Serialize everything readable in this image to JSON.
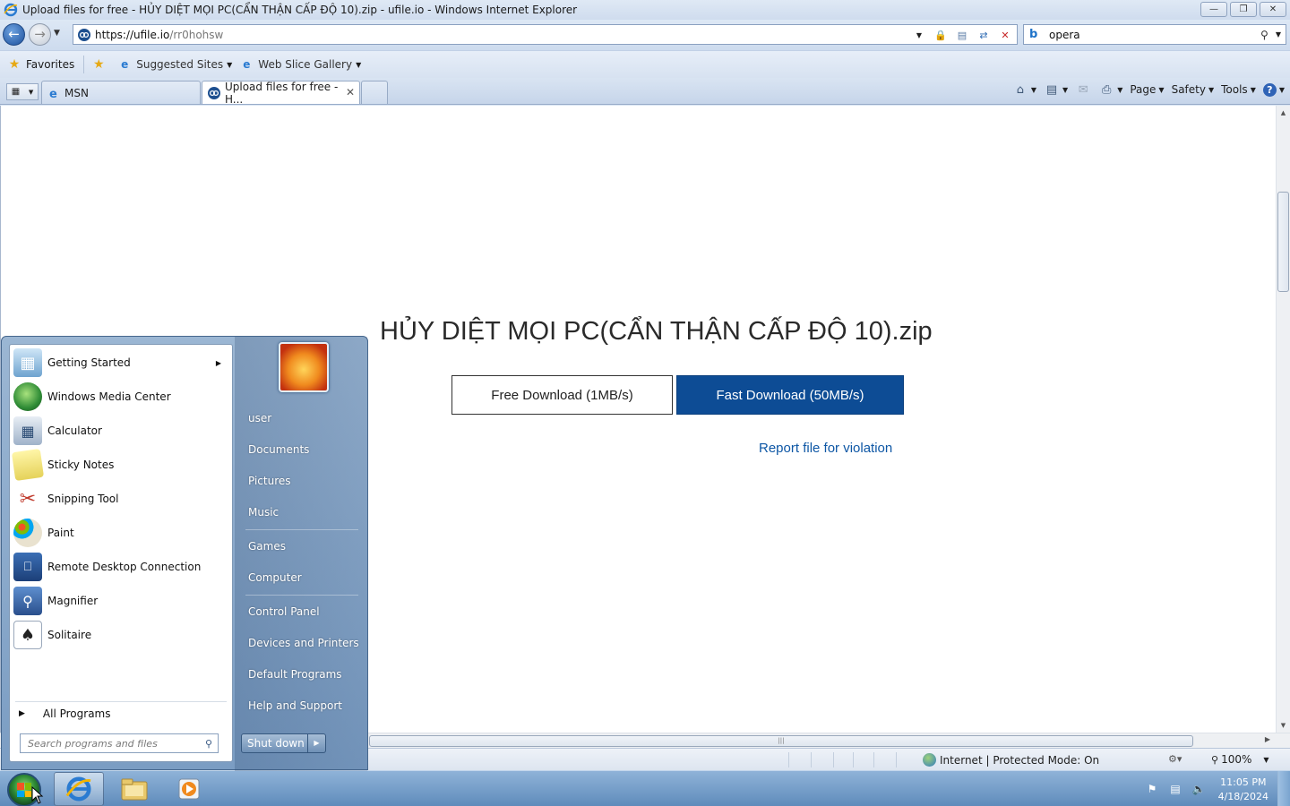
{
  "window": {
    "title": "Upload files for free - HỦY DIỆT MỌI PC(CẨN THẬN CẤP ĐỘ 10).zip - ufile.io - Windows Internet Explorer"
  },
  "address": {
    "url_host": "https://ufile.io",
    "url_path": "/rr0hohsw"
  },
  "search": {
    "query": "opera"
  },
  "favorites_bar": {
    "favorites_label": "Favorites",
    "suggested_sites_label": "Suggested Sites",
    "web_slice_gallery_label": "Web Slice Gallery"
  },
  "tabs": [
    {
      "label": "MSN"
    },
    {
      "label": "Upload files for free - H..."
    }
  ],
  "command_bar": {
    "page_label": "Page",
    "safety_label": "Safety",
    "tools_label": "Tools"
  },
  "page": {
    "file_title": "HỦY DIỆT MỌI PC(CẨN THẬN CẤP ĐỘ 10).zip",
    "free_download_label": "Free Download (1MB/s)",
    "fast_download_label": "Fast Download (50MB/s)",
    "report_link_label": "Report file for violation",
    "colors": {
      "fast_button": "#0d4c95",
      "link": "#0e57a5"
    }
  },
  "status_bar": {
    "zone_text": "Internet | Protected Mode: On",
    "zoom_text": "100%"
  },
  "start_menu": {
    "programs": [
      {
        "label": "Getting Started",
        "icon": "getting-started-icon"
      },
      {
        "label": "Windows Media Center",
        "icon": "media-center-icon"
      },
      {
        "label": "Calculator",
        "icon": "calculator-icon"
      },
      {
        "label": "Sticky Notes",
        "icon": "sticky-notes-icon"
      },
      {
        "label": "Snipping Tool",
        "icon": "snipping-tool-icon"
      },
      {
        "label": "Paint",
        "icon": "paint-icon"
      },
      {
        "label": "Remote Desktop Connection",
        "icon": "remote-desktop-icon"
      },
      {
        "label": "Magnifier",
        "icon": "magnifier-icon"
      },
      {
        "label": "Solitaire",
        "icon": "solitaire-icon"
      }
    ],
    "all_programs_label": "All Programs",
    "search_placeholder": "Search programs and files",
    "right_links": {
      "user": "user",
      "documents": "Documents",
      "pictures": "Pictures",
      "music": "Music",
      "games": "Games",
      "computer": "Computer",
      "control_panel": "Control Panel",
      "devices_printers": "Devices and Printers",
      "default_programs": "Default Programs",
      "help_support": "Help and Support"
    },
    "shutdown_label": "Shut down"
  },
  "taskbar": {
    "time": "11:05 PM",
    "date": "4/18/2024"
  }
}
